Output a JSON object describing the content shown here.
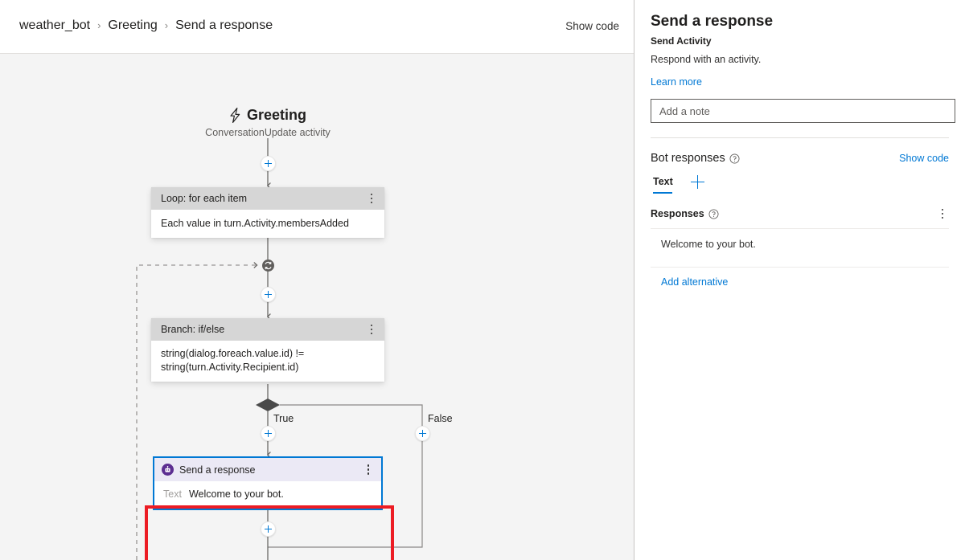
{
  "toolbar": {
    "breadcrumb": [
      "weather_bot",
      "Greeting",
      "Send a response"
    ],
    "separator": "›",
    "show_code_label": "Show code"
  },
  "canvas": {
    "trigger": {
      "icon": "lightning-bolt-icon",
      "title": "Greeting",
      "subtitle": "ConversationUpdate activity"
    },
    "nodes": [
      {
        "id": "loop",
        "header": "Loop: for each item",
        "body": "Each value in turn.Activity.membersAdded"
      },
      {
        "id": "branch",
        "header": "Branch: if/else",
        "body": "string(dialog.foreach.value.id) !=\nstring(turn.Activity.Recipient.id)"
      },
      {
        "id": "send",
        "icon": "bot-icon",
        "header": "Send a response",
        "field_label": "Text",
        "field_value": "Welcome to your bot."
      }
    ],
    "edge_labels": {
      "true": "True",
      "false": "False"
    },
    "add_button_label": "+",
    "colors": {
      "selection_blue": "#0078d4",
      "highlight_red": "#ec1c24",
      "bot_purple": "#5c2e91",
      "node_header_gray": "#d6d6d6",
      "send_header_lavender": "#ebe9f5",
      "canvas_bg": "#f4f4f4"
    }
  },
  "panel": {
    "title": "Send a response",
    "subtitle": "Send Activity",
    "description": "Respond with an activity.",
    "learn_more_label": "Learn more",
    "note_placeholder": "Add a note",
    "note_value": "",
    "bot_responses": {
      "section_label": "Bot responses",
      "show_code_label": "Show code",
      "tabs": [
        {
          "label": "Text",
          "selected": true
        }
      ],
      "add_tab_label": "+",
      "responses_label": "Responses",
      "items": [
        {
          "text": "Welcome to your bot."
        }
      ],
      "add_alternative_label": "Add alternative"
    }
  }
}
